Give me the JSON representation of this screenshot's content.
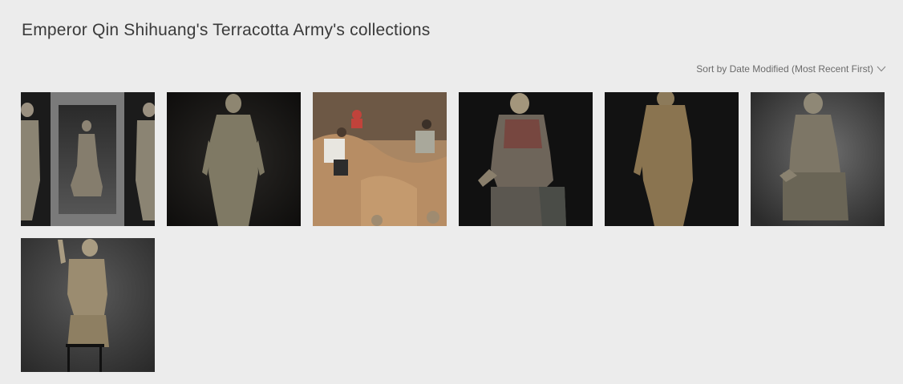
{
  "header": {
    "title": "Emperor Qin Shihuang's Terracotta Army's collections"
  },
  "sort": {
    "label": "Sort by Date Modified (Most Recent First)",
    "icon": "chevron-down-icon"
  },
  "collection": {
    "items": [
      {
        "subject": "three kneeling archer figures"
      },
      {
        "subject": "standing terracotta warrior"
      },
      {
        "subject": "excavation site with workers"
      },
      {
        "subject": "kneeling painted archer"
      },
      {
        "subject": "standing terracotta warrior side view"
      },
      {
        "subject": "kneeling archer figure"
      },
      {
        "subject": "terracotta figure with raised arm on stand"
      }
    ]
  }
}
